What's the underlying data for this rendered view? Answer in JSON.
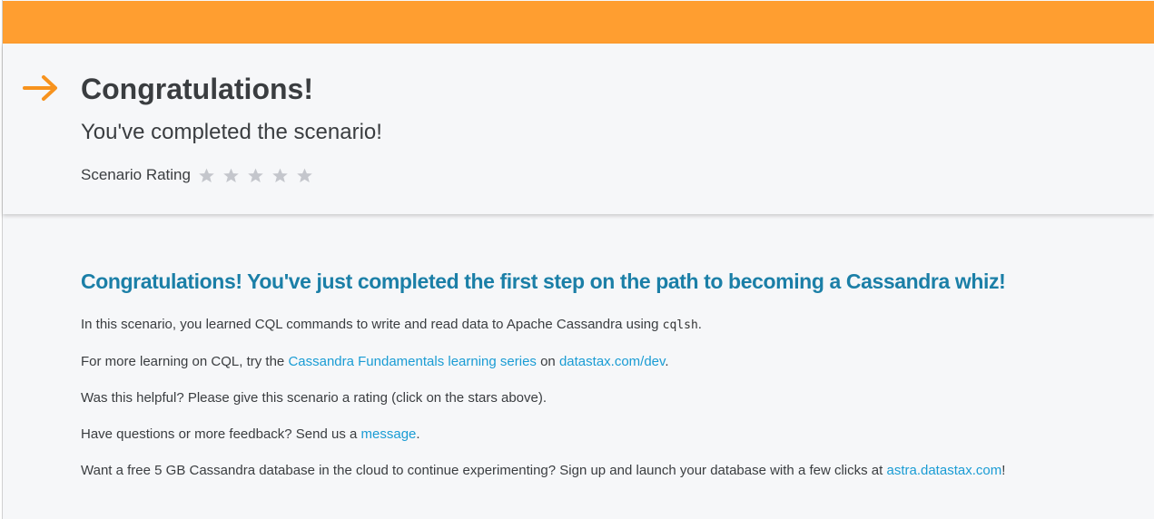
{
  "header": {
    "title": "Congratulations!",
    "subtitle": "You've completed the scenario!",
    "rating_label": "Scenario Rating",
    "stars": [
      {
        "icon": "star-icon"
      },
      {
        "icon": "star-icon"
      },
      {
        "icon": "star-icon"
      },
      {
        "icon": "star-icon"
      },
      {
        "icon": "star-icon"
      }
    ],
    "rating_value": 0,
    "rating_max": 5,
    "icon": "arrow-right-icon"
  },
  "content": {
    "heading": "Congratulations! You've just completed the first step on the path to becoming a Cassandra whiz!",
    "p1": {
      "text": "In this scenario, you learned CQL commands to write and read data to Apache Cassandra using ",
      "code": "cqlsh",
      "end": "."
    },
    "p2": {
      "text": "For more learning on CQL, try the ",
      "link1": "Cassandra Fundamentals learning series",
      "mid": " on ",
      "link2": "datastax.com/dev",
      "end": "."
    },
    "p3": {
      "text": "Was this helpful? Please give this scenario a rating (click on the stars above)."
    },
    "p4": {
      "text": "Have questions or more feedback? Send us a ",
      "link": "message",
      "end": "."
    },
    "p5": {
      "text": "Want a free 5 GB Cassandra database in the cloud to continue experimenting? Sign up and launch your database with a few clicks at ",
      "link": "astra.datastax.com",
      "end": "!"
    }
  },
  "colors": {
    "top_bar": "#ff9e30",
    "accent_arrow": "#f7931e",
    "heading": "#1b7fa7",
    "link": "#1a9cd4",
    "star_empty": "#c4c6cc"
  }
}
